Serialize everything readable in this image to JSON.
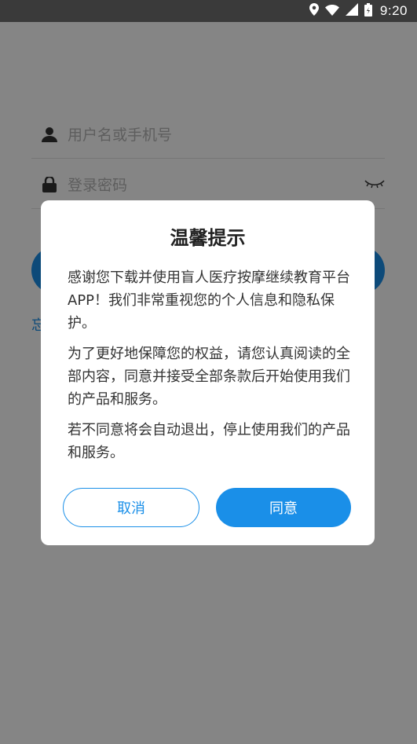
{
  "status_bar": {
    "time": "9:20",
    "icons": [
      "location-icon",
      "wifi-icon",
      "signal-icon",
      "battery-icon"
    ]
  },
  "login": {
    "username_placeholder": "用户名或手机号",
    "password_placeholder": "登录密码",
    "forgot_link": "忘"
  },
  "dialog": {
    "title": "温馨提示",
    "paragraphs": [
      "感谢您下载并使用盲人医疗按摩继续教育平台APP！我们非常重视您的个人信息和隐私保护。",
      "为了更好地保障您的权益，请您认真阅读的全部内容，同意并接受全部条款后开始使用我们的产品和服务。",
      "若不同意将会自动退出，停止使用我们的产品和服务。"
    ],
    "cancel_label": "取消",
    "agree_label": "同意"
  },
  "colors": {
    "accent": "#1a8fe8",
    "statusbar": "#3a3a3a",
    "overlay": "rgba(0,0,0,0.48)"
  }
}
